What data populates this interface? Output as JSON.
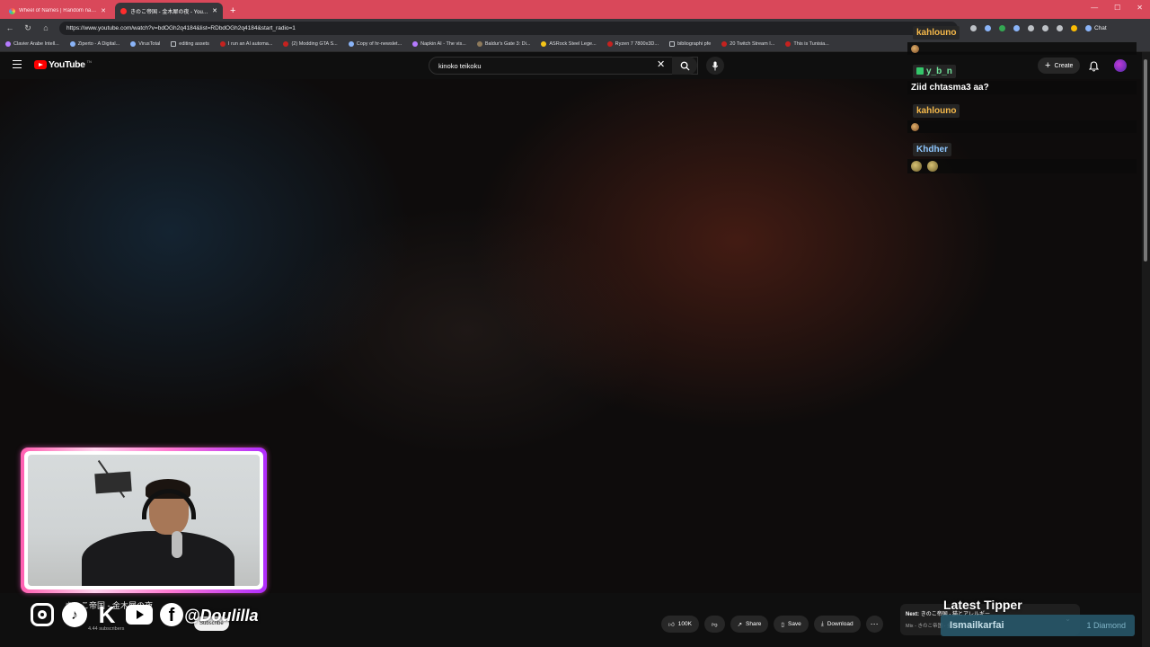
{
  "browser": {
    "tabs": [
      {
        "title": "Wheel of Names | Random name ...",
        "active": false,
        "favicon": "wheel-icon"
      },
      {
        "title": "きのこ帝国 - 金木犀の夜 - YouTube",
        "active": true,
        "favicon": "youtube-icon"
      }
    ],
    "url": "https://www.youtube.com/watch?v=bdOGh2q4184&list=RDbdOGh2q4184&start_radio=1",
    "chat_extension_label": "Chat",
    "bookmarks": [
      "Clavier Arabe Intell...",
      "Ziperto - A Digital...",
      "VirusTotal",
      "editing assets",
      "I run an AI automa...",
      "(2) Modding GTA S...",
      "Copy of hr-newslet...",
      "Napkin AI - The vis...",
      "Baldur's Gate 3: Di...",
      "ASRock Steel Lege...",
      "Ryzen 7 7800x3D...",
      "bibliographi pfe",
      "20 Twitch Stream I...",
      "This is Tunisia..."
    ]
  },
  "youtube": {
    "logo_text": "YouTube",
    "logo_suffix": "TN",
    "search_value": "kinoko teikoku",
    "create_label": "Create",
    "video_title": "きのこ帝国 - 金木犀の夜",
    "subscribers": "4.44 subscribers",
    "subscribe_label": "Subscribe",
    "actions": {
      "likes": "100K",
      "share": "Share",
      "save": "Save",
      "download": "Download"
    },
    "next": {
      "label": "Next:",
      "title": "きのこ帝国 - 猫とアレルギー",
      "mix": "Mix - きのこ帝国 - 金木犀の夜"
    }
  },
  "overlay": {
    "handle": "@Doulilla",
    "socials": [
      "instagram-icon",
      "tiktok-icon",
      "kick-icon",
      "youtube-icon",
      "facebook-icon"
    ],
    "chat": [
      {
        "user": "kahlouno",
        "color": "#f6b94a",
        "message": "",
        "emotes": 1
      },
      {
        "user": "y_b_n",
        "color": "#71e39a",
        "message": "Ziid chtasma3 aa?",
        "emotes": 0
      },
      {
        "user": "kahlouno",
        "color": "#f6b94a",
        "message": "",
        "emotes": 1
      },
      {
        "user": "Khdher",
        "color": "#8fc7ff",
        "message": "",
        "emotes": 2
      }
    ],
    "latest_tipper": {
      "title": "Latest Tipper",
      "name": "Ismailkarfai",
      "amount": "1 Diamond"
    }
  }
}
